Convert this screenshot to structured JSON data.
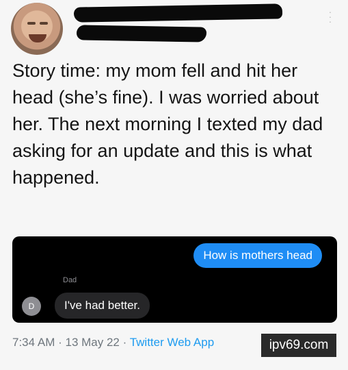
{
  "tweet": {
    "text": "Story time: my mom fell and hit her head (she’s fine). I was worried about her. The next morning I texted my dad asking for an update and this is what happened.",
    "meta": {
      "time": "7:34 AM",
      "separator": " · ",
      "date": "13 May 22",
      "source": "Twitter Web App"
    },
    "more_icon": "more-vertical-icon"
  },
  "conversation": {
    "outgoing": "How is mothers head",
    "sender_name": "Dad",
    "sender_initial": "D",
    "incoming": "I've had better."
  },
  "watermark": "ipv69.com",
  "colors": {
    "imessage_blue": "#1f8df5",
    "link_blue": "#1d9bf0",
    "chat_background": "#000000"
  }
}
